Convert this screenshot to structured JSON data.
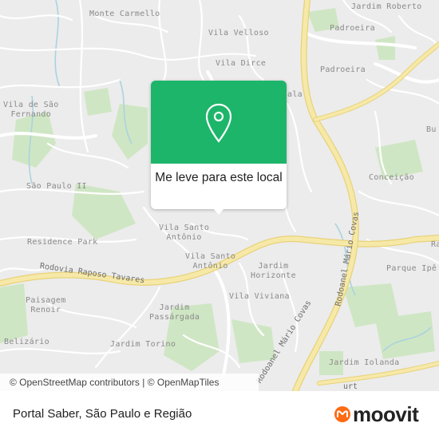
{
  "map": {
    "places": [
      {
        "id": "monte-carmello",
        "text": "Monte Carmello"
      },
      {
        "id": "jardim-roberto",
        "text": "Jardim Roberto"
      },
      {
        "id": "padroeira-1",
        "text": "Padroeira"
      },
      {
        "id": "vila-velloso",
        "text": "Vila Velloso"
      },
      {
        "id": "vila-dirce",
        "text": "Vila Dirce"
      },
      {
        "id": "padroeira-2",
        "text": "Padroeira"
      },
      {
        "id": "vila-de-sao-fernando",
        "text": "Vila de São\nFernando"
      },
      {
        "id": "bu",
        "text": "Bu"
      },
      {
        "id": "conceicao",
        "text": "Conceição"
      },
      {
        "id": "sao-paulo-ii",
        "text": "São Paulo II"
      },
      {
        "id": "vila-santo-antonio-1",
        "text": "Vila Santo\nAntônio"
      },
      {
        "id": "residence-park",
        "text": "Residence Park"
      },
      {
        "id": "vila-santo-antonio-2",
        "text": "Vila Santo\nAntônio"
      },
      {
        "id": "jardim-horizonte",
        "text": "Jardim\nHorizonte"
      },
      {
        "id": "parque-ipe",
        "text": "Parque Ipê"
      },
      {
        "id": "ra",
        "text": "Ra"
      },
      {
        "id": "vila-viviana",
        "text": "Vila Viviana"
      },
      {
        "id": "paisagem-renoir",
        "text": "Paisagem\nRenoir"
      },
      {
        "id": "jardim-passargada",
        "text": "Jardim\nPassárgada"
      },
      {
        "id": "belizario",
        "text": "Belizário"
      },
      {
        "id": "jardim-torino",
        "text": "Jardim Torino"
      },
      {
        "id": "jardim-iolanda",
        "text": "Jardim Iolanda"
      },
      {
        "id": "ala",
        "text": "ala"
      }
    ],
    "roads": {
      "rodovia_raposo_tavares": "Rodovia Raposo Tavares",
      "rodoanel_1": "Rodoanel Mário Covas",
      "rodoanel_2": "Rodoanel Mário Covas",
      "partial": "urt"
    },
    "attribution": "© OpenStreetMap contributors | © OpenMapTiles",
    "colors": {
      "land": "#ececec",
      "park": "#cfe6c4",
      "road": "#ffffff",
      "highway": "#f6e9a8",
      "highway_edge": "#e8d27a",
      "water": "#aad3df"
    }
  },
  "popup": {
    "label": "Me leve para este local",
    "accent": "#1db56a",
    "icon": "location-pin-icon"
  },
  "footer": {
    "title": "Portal Saber, São Paulo e Região",
    "logo_text": "moovit",
    "logo_accent": "#ff6a13"
  }
}
